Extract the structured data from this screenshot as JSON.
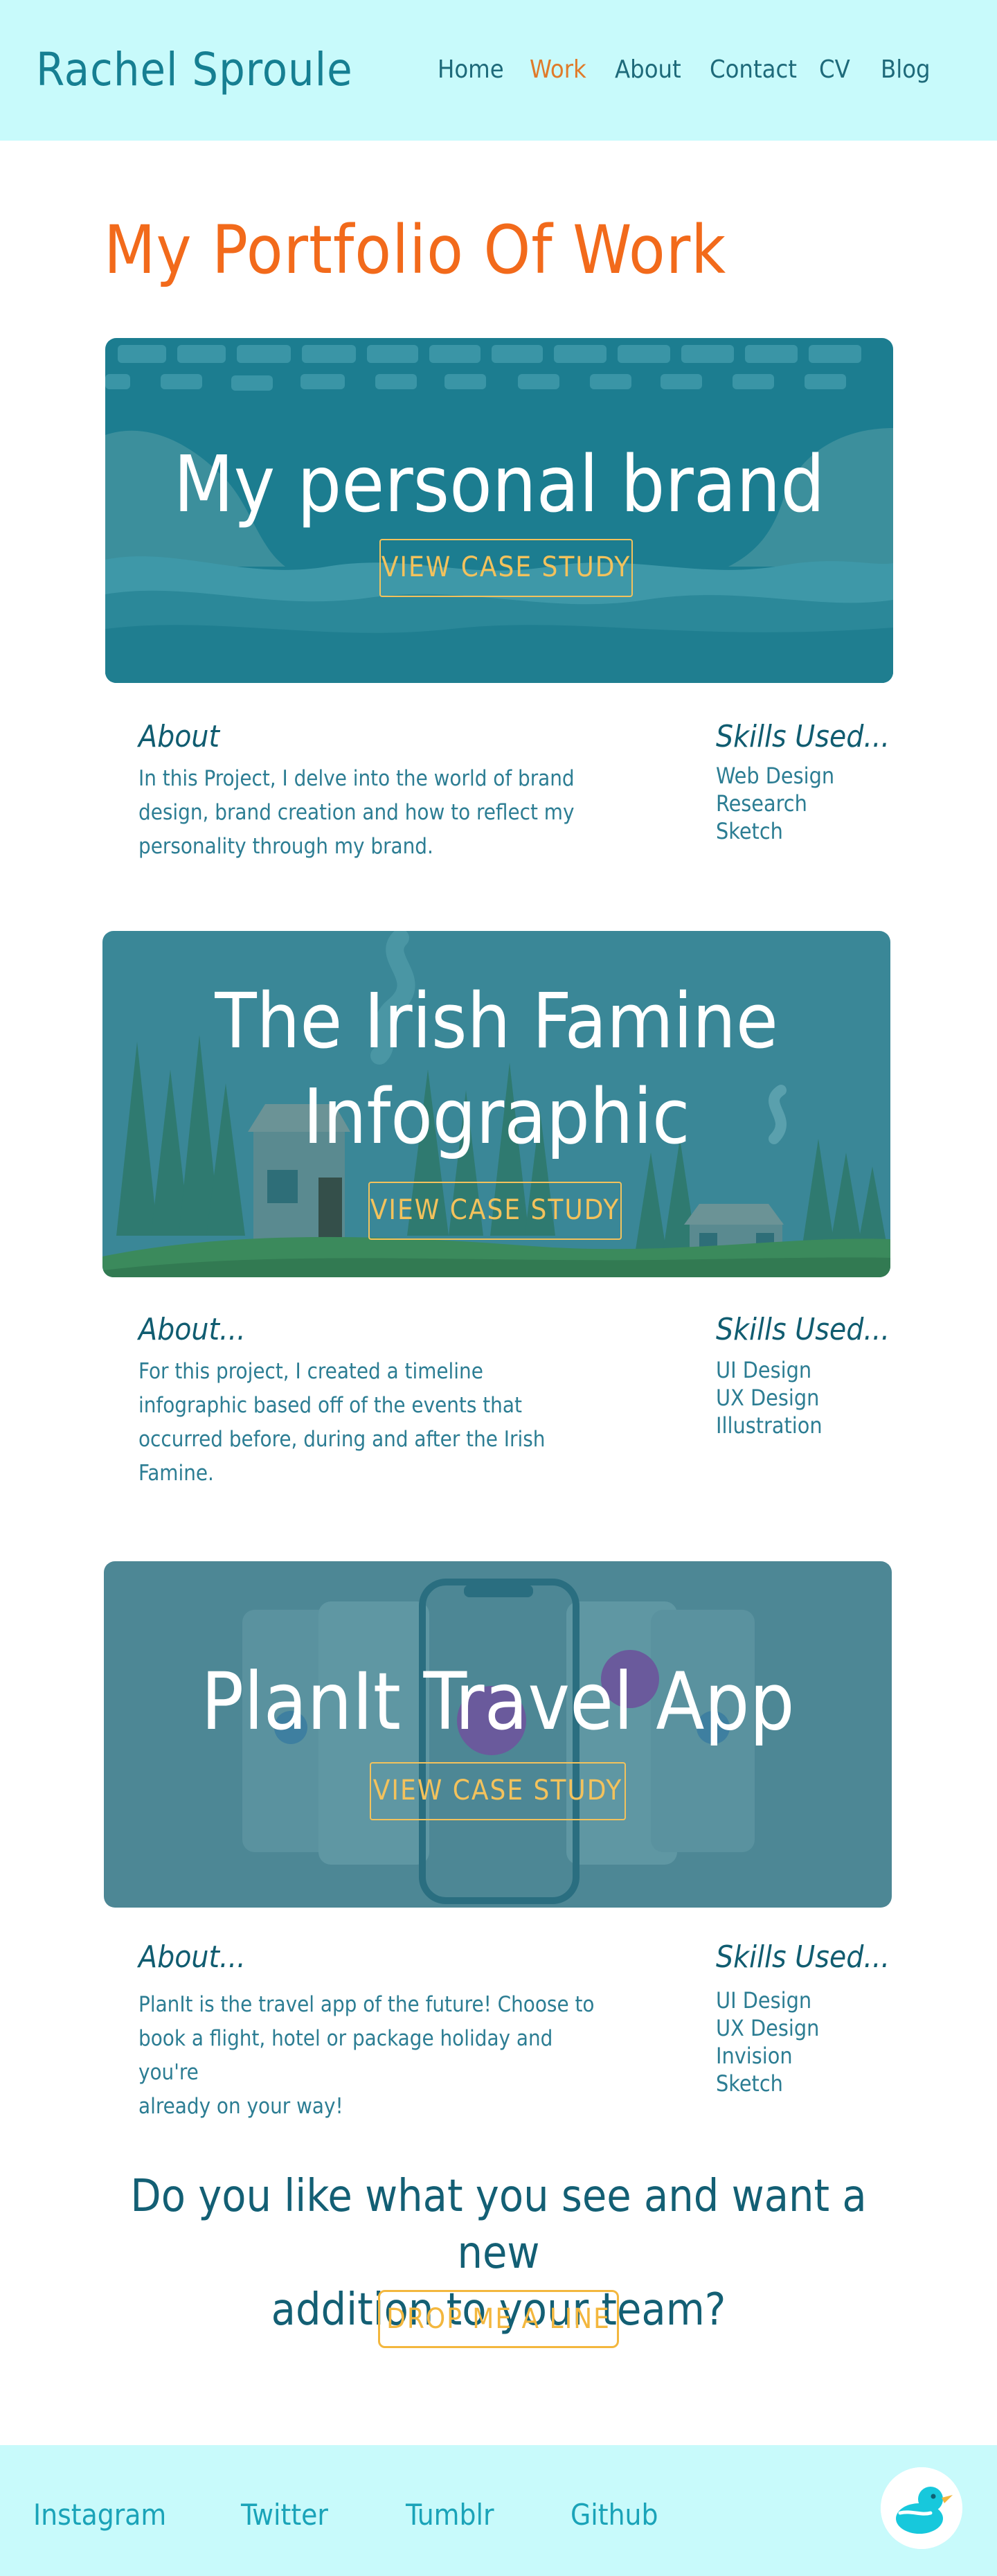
{
  "header": {
    "brand": "Rachel Sproule",
    "nav": [
      "Home",
      "Work",
      "About",
      "Contact",
      "CV",
      "Blog"
    ],
    "active": "Work"
  },
  "page_title": "My Portfolio Of Work",
  "projects": [
    {
      "title": "My personal brand",
      "cta": "VIEW CASE STUDY",
      "about_heading": "About",
      "about_lines": [
        "In this Project, I delve into the world of brand",
        "design, brand creation and how to reflect my",
        "personality through my brand."
      ],
      "skills_heading": "Skills Used...",
      "skills": [
        "Web Design",
        "Research",
        "Sketch"
      ]
    },
    {
      "title_line1": "The Irish Famine",
      "title_line2": "Infographic",
      "cta": "VIEW CASE STUDY",
      "about_heading": "About...",
      "about_lines": [
        "For this project, I created a timeline",
        "infographic based off of the events that",
        "occurred before, during and after the Irish",
        "Famine."
      ],
      "skills_heading": "Skills Used...",
      "skills": [
        "UI Design",
        "UX Design",
        "Illustration"
      ]
    },
    {
      "title": "PlanIt Travel App",
      "cta": "VIEW CASE STUDY",
      "about_heading": "About...",
      "about_lines": [
        "PlanIt is the travel app of the future! Choose to",
        "book a flight, hotel or package holiday and you're",
        "already on your way!"
      ],
      "skills_heading": "Skills Used...",
      "skills": [
        "UI Design",
        "UX Design",
        "Invision",
        "Sketch"
      ]
    }
  ],
  "contact": {
    "line1": "Do you like what you see and want a new",
    "line2": "addition to your team?",
    "button": "DROP ME A LINE"
  },
  "footer": {
    "links": [
      "Instagram",
      "Twitter",
      "Tumblr",
      "Github"
    ]
  },
  "colors": {
    "header_bg": "#c8fafb",
    "accent_orange": "#f26a1b",
    "cta_yellow": "#f3c25c",
    "teal_dark": "#135f74"
  }
}
